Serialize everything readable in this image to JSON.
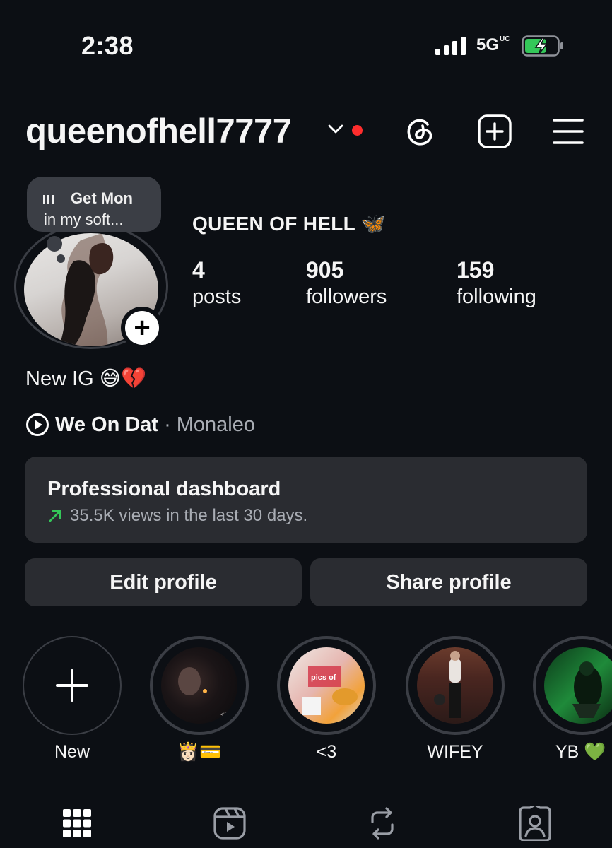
{
  "status_bar": {
    "time": "2:38",
    "network": "5G",
    "network_suffix": "UC"
  },
  "header": {
    "username": "queenofhell7777"
  },
  "note": {
    "line1": "Get Mon",
    "line2": "in my soft..."
  },
  "profile": {
    "display_name": "QUEEN OF HELL 🦋"
  },
  "stats": [
    {
      "count": "4",
      "label": "posts"
    },
    {
      "count": "905",
      "label": "followers"
    },
    {
      "count": "159",
      "label": "following"
    }
  ],
  "bio": "New IG 😅💔",
  "music": {
    "song": "We On Dat",
    "separator": "·",
    "artist": "Monaleo"
  },
  "professional_dashboard": {
    "title": "Professional dashboard",
    "subtitle": "35.5K views in the last 30 days.",
    "trend_icon": "arrow-up-right-icon",
    "trend_color": "#34c759"
  },
  "buttons": {
    "edit": "Edit profile",
    "share": "Share profile"
  },
  "highlights": [
    {
      "label": "New"
    },
    {
      "label": "👸🏻💳"
    },
    {
      "label": "<3"
    },
    {
      "label": "WIFEY"
    },
    {
      "label": "YB 💚"
    }
  ],
  "highlight_fragments": {
    "h2_caption": "<3",
    "h3_text": "pics of"
  },
  "colors": {
    "background": "#0c0f14",
    "card": "#2a2c31",
    "accent_red": "#ff2d2d",
    "battery_green": "#34c759"
  }
}
